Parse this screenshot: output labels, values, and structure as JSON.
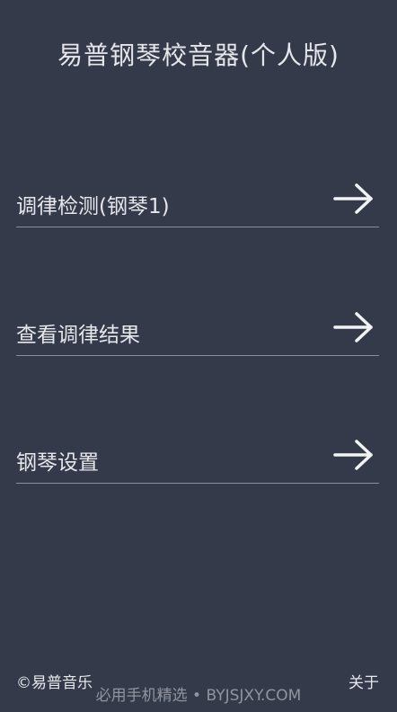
{
  "header": {
    "title": "易普钢琴校音器(个人版)"
  },
  "menu": {
    "items": [
      {
        "label": "调律检测(钢琴1)",
        "icon": "arrow-right-icon"
      },
      {
        "label": "查看调律结果",
        "icon": "arrow-right-icon"
      },
      {
        "label": "钢琴设置",
        "icon": "arrow-right-icon"
      }
    ]
  },
  "footer": {
    "copyright": "©易普音乐",
    "about_label": "关于"
  },
  "watermark": {
    "text": "必用手机精选 • BYJSJXY.COM"
  },
  "colors": {
    "background": "#353a4b",
    "text": "#e6e7ea",
    "divider": "#8a8e9b"
  }
}
